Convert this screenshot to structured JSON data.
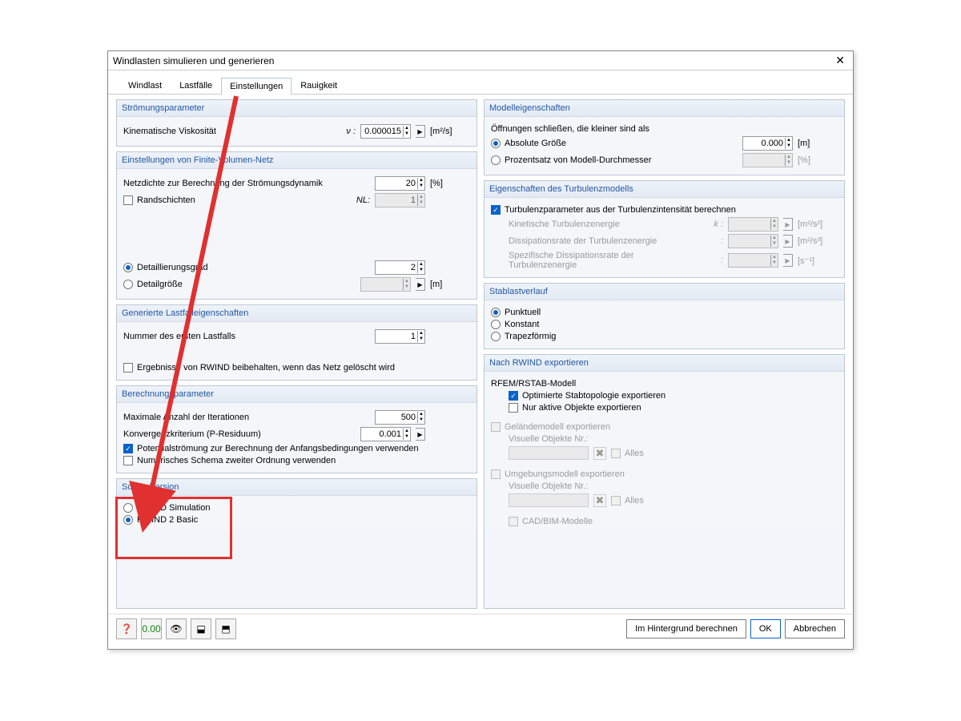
{
  "dialog": {
    "title": "Windlasten simulieren und generieren"
  },
  "tabs": {
    "t1": "Windlast",
    "t2": "Lastfälle",
    "t3": "Einstellungen",
    "t4": "Rauigkeit"
  },
  "flow": {
    "heading": "Strömungsparameter",
    "visc_label": "Kinematische Viskosität",
    "visc_sym": "ν :",
    "visc_val": "0.000015",
    "visc_unit": "[m²/s]"
  },
  "fvm": {
    "heading": "Einstellungen von Finite-Volumen-Netz",
    "density_label": "Netzdichte zur Berechnung der Strömungsdynamik",
    "density_val": "20",
    "density_unit": "[%]",
    "bl": "Randschichten",
    "bl_sym": "NL:",
    "bl_val": "1",
    "opt1": "Detaillierungsgrad",
    "opt1_val": "2",
    "opt2": "Detailgröße",
    "opt2_unit": "[m]"
  },
  "gen": {
    "heading": "Generierte Lastfalleigenschaften",
    "first_lc": "Nummer des ersten Lastfalls",
    "first_lc_val": "1",
    "keep": "Ergebnisse von RWIND beibehalten, wenn das Netz gelöscht wird"
  },
  "calc": {
    "heading": "Berechnungsparameter",
    "iter": "Maximale Anzahl der Iterationen",
    "iter_val": "500",
    "conv": "Konvergenzkriterium (P-Residuum)",
    "conv_val": "0.001",
    "pot": "Potentialströmung zur Berechnung der Anfangsbedingungen verwenden",
    "ord2": "Numerisches Schema zweiter Ordnung verwenden"
  },
  "solver": {
    "heading": "Solver-Version",
    "o1": "RWIND Simulation",
    "o2": "RWIND 2 Basic"
  },
  "model": {
    "heading": "Modelleigenschaften",
    "close": "Öffnungen schließen, die kleiner sind als",
    "abs": "Absolute Größe",
    "abs_val": "0.000",
    "abs_unit": "[m]",
    "pct": "Prozentsatz von Modell-Durchmesser",
    "pct_unit": "[%]"
  },
  "turb": {
    "heading": "Eigenschaften des Turbulenzmodells",
    "calc": "Turbulenzparameter aus der Turbulenzintensität berechnen",
    "kin": "Kinetische Turbulenzenergie",
    "kin_sym": "k :",
    "kin_unit": "[m²/s²]",
    "diss": "Dissipationsrate der Turbulenzenergie",
    "diss_sym": ":",
    "diss_unit": "[m²/s³]",
    "spec": "Spezifische Dissipationsrate der Turbulenzenergie",
    "spec_sym": ":",
    "spec_unit": "[s⁻¹]"
  },
  "memb": {
    "heading": "Stablastverlauf",
    "o1": "Punktuell",
    "o2": "Konstant",
    "o3": "Trapezförmig"
  },
  "exp": {
    "heading": "Nach RWIND exportieren",
    "sub1": "RFEM/RSTAB-Modell",
    "opt1": "Optimierte Stabtopologie exportieren",
    "opt2": "Nur aktive Objekte exportieren",
    "terr": "Geländemodell exportieren",
    "vis": "Visuelle Objekte Nr.:",
    "alles": "Alles",
    "env": "Umgebungsmodell exportieren",
    "cad": "CAD/BIM-Modelle"
  },
  "footer": {
    "calc": "Im Hintergrund berechnen",
    "ok": "OK",
    "cancel": "Abbrechen"
  }
}
